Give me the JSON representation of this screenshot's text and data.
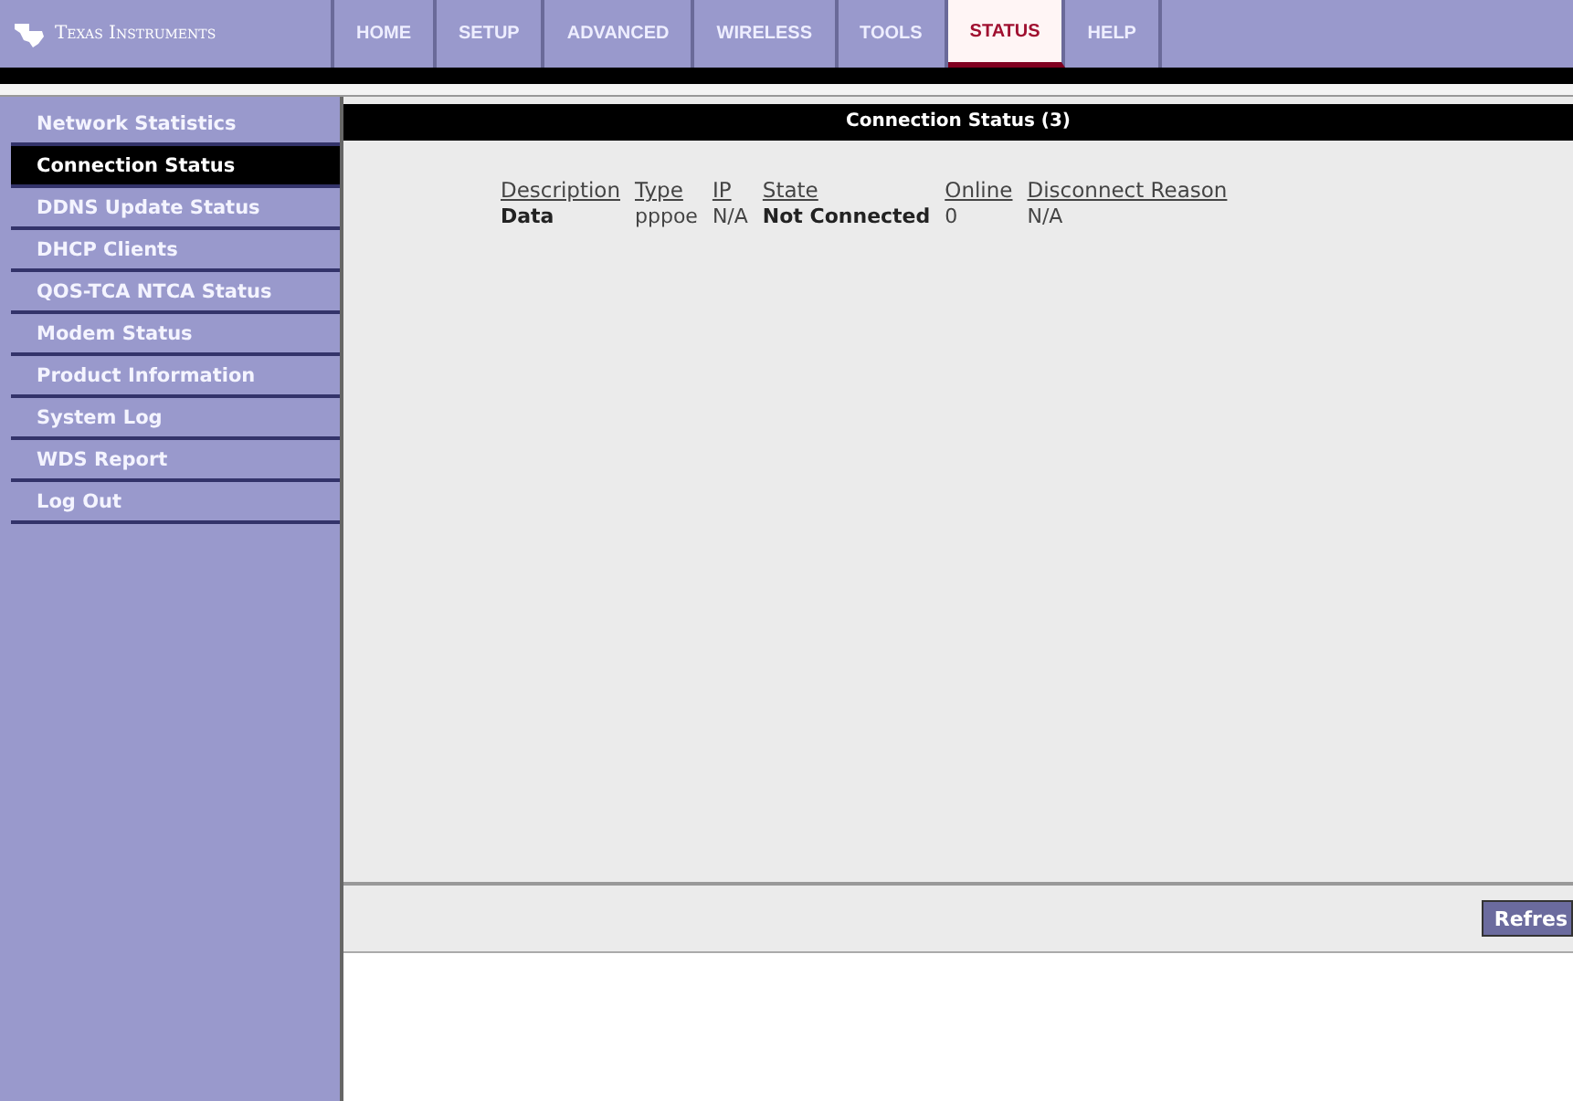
{
  "brand": {
    "name": "Texas Instruments"
  },
  "nav": [
    {
      "label": "HOME",
      "selected": false
    },
    {
      "label": "SETUP",
      "selected": false
    },
    {
      "label": "ADVANCED",
      "selected": false
    },
    {
      "label": "WIRELESS",
      "selected": false
    },
    {
      "label": "TOOLS",
      "selected": false
    },
    {
      "label": "STATUS",
      "selected": true
    },
    {
      "label": "HELP",
      "selected": false
    }
  ],
  "sidebar": {
    "items": [
      {
        "label": "Network Statistics",
        "selected": false
      },
      {
        "label": "Connection Status",
        "selected": true
      },
      {
        "label": "DDNS Update Status",
        "selected": false
      },
      {
        "label": "DHCP Clients",
        "selected": false
      },
      {
        "label": "QOS-TCA NTCA Status",
        "selected": false
      },
      {
        "label": "Modem Status",
        "selected": false
      },
      {
        "label": "Product Information",
        "selected": false
      },
      {
        "label": "System Log",
        "selected": false
      },
      {
        "label": "WDS Report",
        "selected": false
      },
      {
        "label": "Log Out",
        "selected": false
      }
    ]
  },
  "panel": {
    "title": "Connection Status (3)"
  },
  "table": {
    "columns": [
      {
        "label": "Description",
        "bold": true
      },
      {
        "label": "Type",
        "bold": false
      },
      {
        "label": "IP",
        "bold": false
      },
      {
        "label": "State",
        "bold": true
      },
      {
        "label": "Online",
        "bold": false
      },
      {
        "label": "Disconnect Reason",
        "bold": false
      }
    ],
    "rows": [
      [
        "Data",
        "pppoe",
        "N/A",
        "Not Connected",
        "0",
        "N/A"
      ]
    ]
  },
  "buttons": [
    "Refres"
  ]
}
